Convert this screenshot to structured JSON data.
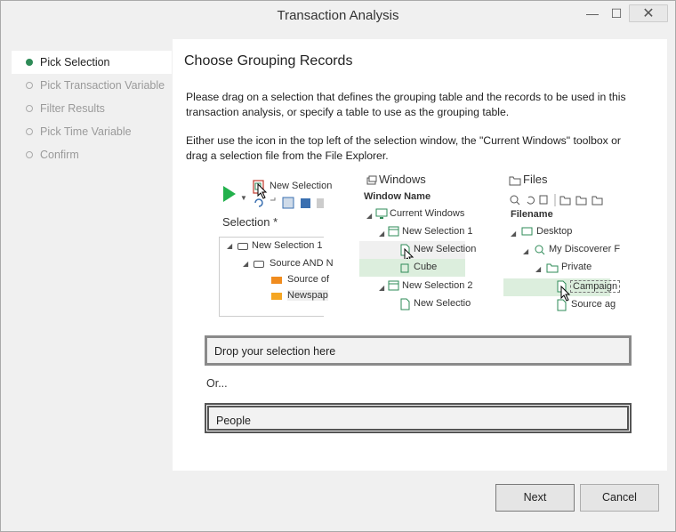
{
  "window": {
    "title": "Transaction Analysis",
    "minimize": "—",
    "maximize": "☐",
    "close": "✕"
  },
  "steps": [
    {
      "label": "Pick Selection",
      "active": true
    },
    {
      "label": "Pick Transaction Variable",
      "active": false
    },
    {
      "label": "Filter Results",
      "active": false
    },
    {
      "label": "Pick Time Variable",
      "active": false
    },
    {
      "label": "Confirm",
      "active": false
    }
  ],
  "panel": {
    "heading": "Choose Grouping Records",
    "para1": "Please drag on a selection that defines the grouping table and the records to be used in this transaction analysis, or specify a table to use as the grouping table.",
    "para2": "Either use the icon in the top left of the selection window, the \"Current Windows\" toolbox or drag a selection file from the File Explorer."
  },
  "illustration": {
    "left": {
      "new_selection": "New Selection",
      "selection_label": "Selection *",
      "tree": [
        "New Selection 1",
        "Source AND N",
        "Source of",
        "Newspap"
      ]
    },
    "windows": {
      "title": "Windows",
      "header": "Window Name",
      "tree": [
        "Current Windows",
        "New Selection 1",
        "New Selection",
        "Cube",
        "New Selection 2",
        "New Selectio"
      ]
    },
    "files": {
      "title": "Files",
      "header": "Filename",
      "tree": [
        "Desktop",
        "My Discoverer F",
        "Private",
        "Campaign",
        "Source ag"
      ]
    }
  },
  "drop": {
    "placeholder": "Drop your selection here"
  },
  "or_label": "Or...",
  "people": {
    "value": "People"
  },
  "buttons": {
    "next": "Next",
    "cancel": "Cancel"
  }
}
